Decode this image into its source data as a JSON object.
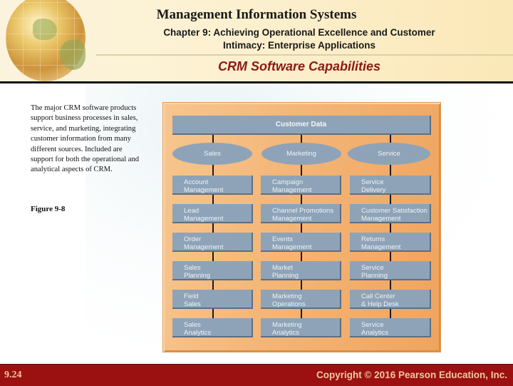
{
  "header": {
    "title": "Management Information Systems",
    "subtitle_line1": "Chapter 9: Achieving Operational Excellence and Customer",
    "subtitle_line2": "Intimacy: Enterprise Applications",
    "section_title": "CRM Software Capabilities"
  },
  "body": {
    "description": "The major CRM software products support business processes in sales, service, and marketing, integrating customer information from many different sources. Included are support for both the operational and analytical aspects of CRM.",
    "figure_label": "Figure 9-8"
  },
  "diagram": {
    "top": "Customer Data",
    "columns": [
      {
        "name": "Sales",
        "items": [
          [
            "Account",
            "Management"
          ],
          [
            "Lead",
            "Management"
          ],
          [
            "Order",
            "Management"
          ],
          [
            "Sales",
            "Planning"
          ],
          [
            "Field",
            "Sales"
          ],
          [
            "Sales",
            "Analytics"
          ]
        ]
      },
      {
        "name": "Marketing",
        "items": [
          [
            "Campaign",
            "Management"
          ],
          [
            "Channel Promotions",
            "Management"
          ],
          [
            "Events",
            "Management"
          ],
          [
            "Market",
            "Planning"
          ],
          [
            "Marketing",
            "Operations"
          ],
          [
            "Marketing",
            "Analytics"
          ]
        ]
      },
      {
        "name": "Service",
        "items": [
          [
            "Service",
            "Delivery"
          ],
          [
            "Customer Satisfaction",
            "Management"
          ],
          [
            "Returns",
            "Management"
          ],
          [
            "Service",
            "Planning"
          ],
          [
            "Call Center",
            "& Help Desk"
          ],
          [
            "Service",
            "Analytics"
          ]
        ]
      }
    ]
  },
  "footer": {
    "slide_number": "9.24",
    "copyright": "Copyright © 2016 Pearson Education, Inc."
  },
  "colors": {
    "accent_red": "#9b1010",
    "section_title": "#8b1a12",
    "figure_orange": "#f4b577",
    "node_blue": "#8ea3b8"
  }
}
